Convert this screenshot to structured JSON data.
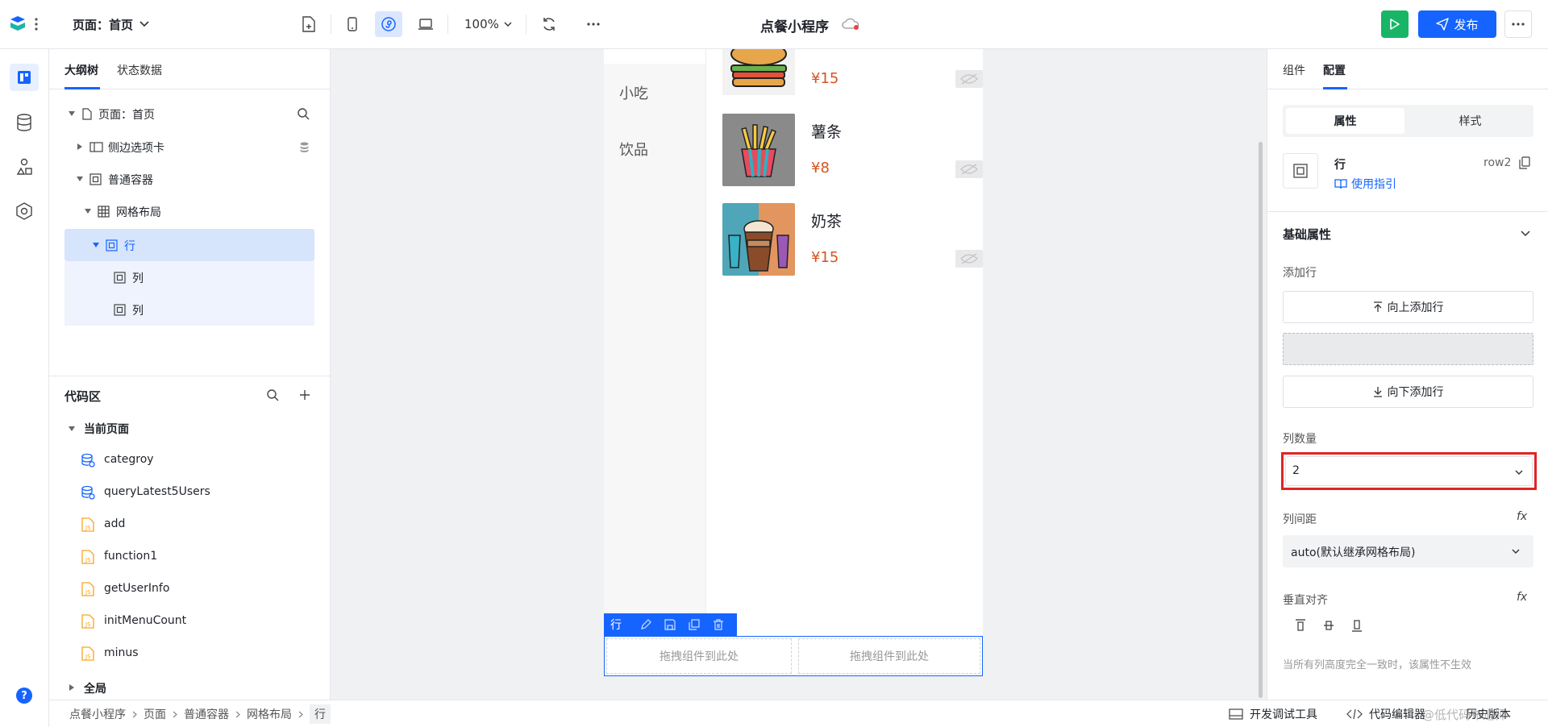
{
  "topbar": {
    "page_selector": "页面：首页",
    "zoom": "100%",
    "app_title": "点餐小程序",
    "publish_label": "发布"
  },
  "left": {
    "tabs": [
      "大纲树",
      "状态数据"
    ],
    "tree": [
      {
        "label": "页面：首页"
      },
      {
        "label": "侧边选项卡"
      },
      {
        "label": "普通容器"
      },
      {
        "label": "网格布局"
      },
      {
        "label": "行"
      },
      {
        "label": "列"
      },
      {
        "label": "列"
      }
    ],
    "code_title": "代码区",
    "current_page": "当前页面",
    "code_items": [
      {
        "label": "categroy",
        "icon": "database-icon"
      },
      {
        "label": "queryLatest5Users",
        "icon": "database-icon"
      },
      {
        "label": "add",
        "icon": "js-file-icon"
      },
      {
        "label": "function1",
        "icon": "js-file-icon"
      },
      {
        "label": "getUserInfo",
        "icon": "js-file-icon"
      },
      {
        "label": "initMenuCount",
        "icon": "js-file-icon"
      },
      {
        "label": "minus",
        "icon": "js-file-icon"
      }
    ],
    "global": "全局"
  },
  "canvas": {
    "side_tabs": [
      "小吃",
      "饮品"
    ],
    "products": [
      {
        "name": "",
        "price": "¥15"
      },
      {
        "name": "薯条",
        "price": "¥8"
      },
      {
        "name": "奶茶",
        "price": "¥15"
      }
    ],
    "row_tag": "行",
    "drop_hint": "拖拽组件到此处"
  },
  "right": {
    "tabs": [
      "组件",
      "配置"
    ],
    "seg": [
      "属性",
      "样式"
    ],
    "comp_name": "行",
    "comp_id": "row2",
    "guide": "使用指引",
    "section": "基础属性",
    "add_row_label": "添加行",
    "add_up": "向上添加行",
    "add_down": "向下添加行",
    "col_count_label": "列数量",
    "col_count_value": "2",
    "col_gap_label": "列间距",
    "col_gap_value": "auto(默认继承网格布局)",
    "valign_label": "垂直对齐",
    "hint": "当所有列高度完全一致时，该属性不生效",
    "fx": "fx"
  },
  "status": {
    "breadcrumb": [
      "点餐小程序",
      "页面",
      "普通容器",
      "网格布局",
      "行"
    ],
    "dev_tools": "开发调试工具",
    "code_editor": "代码编辑器",
    "history": "历史版本",
    "watermark": "@低代码布道师"
  },
  "colors": {
    "accent": "#1664ff",
    "price": "#d9531e",
    "highlight_border": "#e02424"
  }
}
